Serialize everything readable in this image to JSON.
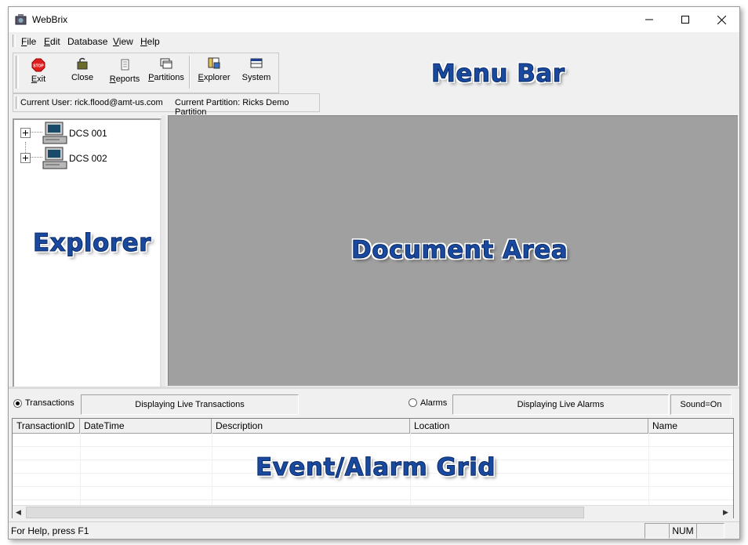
{
  "window": {
    "title": "WebBrix"
  },
  "menu": [
    {
      "underline": "F",
      "rest": "ile"
    },
    {
      "underline": "E",
      "rest": "dit"
    },
    {
      "underline": "",
      "rest": "Database"
    },
    {
      "underline": "V",
      "rest": "iew"
    },
    {
      "underline": "H",
      "rest": "elp"
    }
  ],
  "toolbar": {
    "exit": {
      "underline": "E",
      "rest": "xit"
    },
    "close": "Close",
    "reports": {
      "underline": "R",
      "rest": "eports"
    },
    "partitions": {
      "underline": "P",
      "rest": "artitions"
    },
    "explorer": {
      "underline": "E",
      "rest": "xplorer"
    },
    "system": "System"
  },
  "userbar": {
    "current_user": "Current User: rick.flood@amt-us.com",
    "current_partition": "Current Partition: Ricks Demo Partition"
  },
  "explorer": {
    "items": [
      "DCS 001",
      "DCS 002"
    ]
  },
  "events": {
    "transactions_label": "Transactions",
    "transactions_status": "Displaying Live Transactions",
    "alarms_label": "Alarms",
    "alarms_status": "Displaying Live Alarms",
    "sound": "Sound=On",
    "columns": [
      "TransactionID",
      "DateTime",
      "Description",
      "Location",
      "Name"
    ]
  },
  "statusbar": {
    "help": "For Help, press F1",
    "num": "NUM"
  },
  "overlays": {
    "menu_bar": "Menu Bar",
    "explorer": "Explorer",
    "document_area": "Document Area",
    "grid": "Event/Alarm Grid"
  },
  "colors": {
    "overlay_text": "#1a4aa0",
    "document_bg": "#a0a0a0",
    "chrome_bg": "#f0f0f0"
  }
}
